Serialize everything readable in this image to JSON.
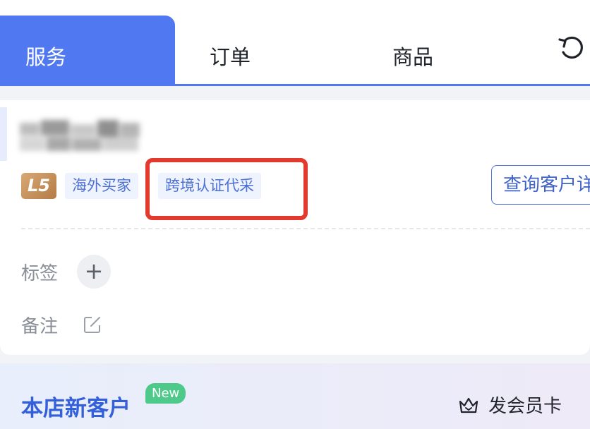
{
  "tabs": {
    "active": "服务",
    "order": "订单",
    "goods": "商品"
  },
  "customer": {
    "level": "L5",
    "tags": [
      "海外买家",
      "跨境认证代采"
    ],
    "query_button": "查询客户详情",
    "tags_label": "标签",
    "add_tag": "+",
    "notes_label": "备注"
  },
  "bottom": {
    "title": "本店新客户",
    "badge": "New",
    "member_card": "发会员卡"
  },
  "colors": {
    "accent": "#5078f0",
    "highlight": "#e23a2f",
    "new_badge": "#4dc98a",
    "level_badge": "#c08a52"
  }
}
